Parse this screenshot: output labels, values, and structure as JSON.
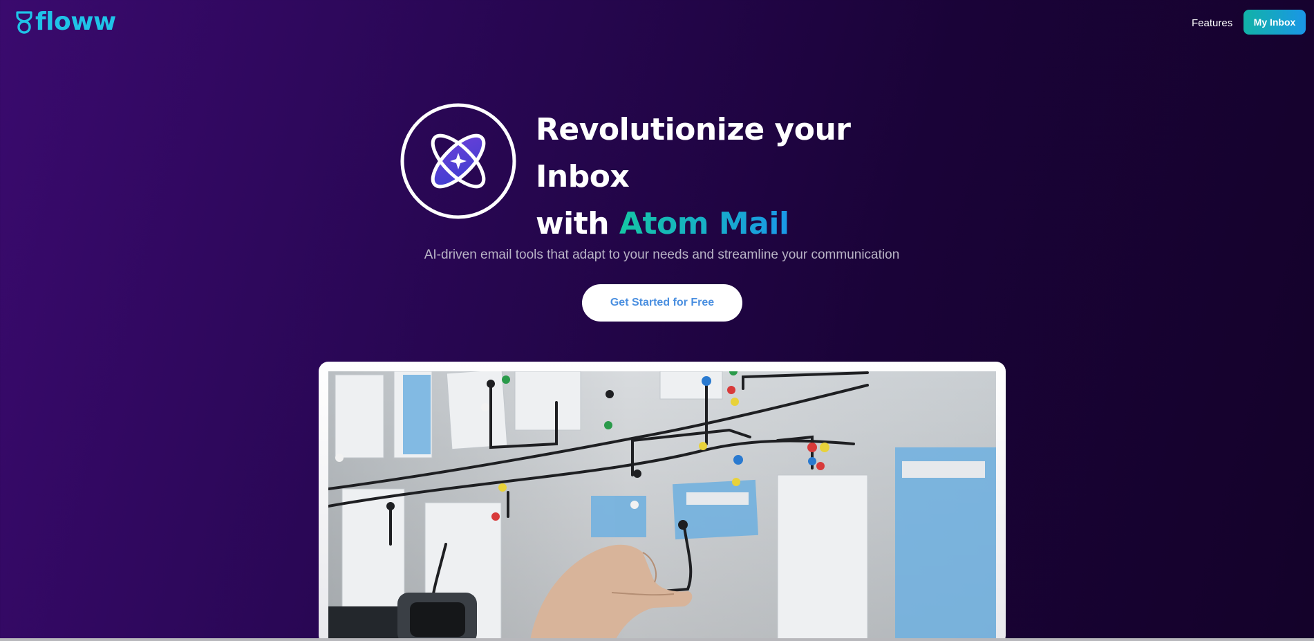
{
  "brand": {
    "name": "floww"
  },
  "nav": {
    "features_label": "Features",
    "inbox_label": "My Inbox"
  },
  "hero": {
    "title_line1": "Revolutionize your Inbox",
    "title_prefix": "with ",
    "title_accent": "Atom Mail",
    "subtitle": "AI-driven email tools that adapt to your needs and streamline your communication",
    "cta_label": "Get Started for Free"
  },
  "colors": {
    "background_start": "#3a0a6e",
    "background_end": "#14022a",
    "brand": "#1fc3e8",
    "accent_start": "#15c6a4",
    "accent_end": "#1a98e8",
    "cta_text": "#4a8fe0"
  },
  "icons": {
    "logo": "floww-logo-icon",
    "emblem": "atom-icon"
  }
}
